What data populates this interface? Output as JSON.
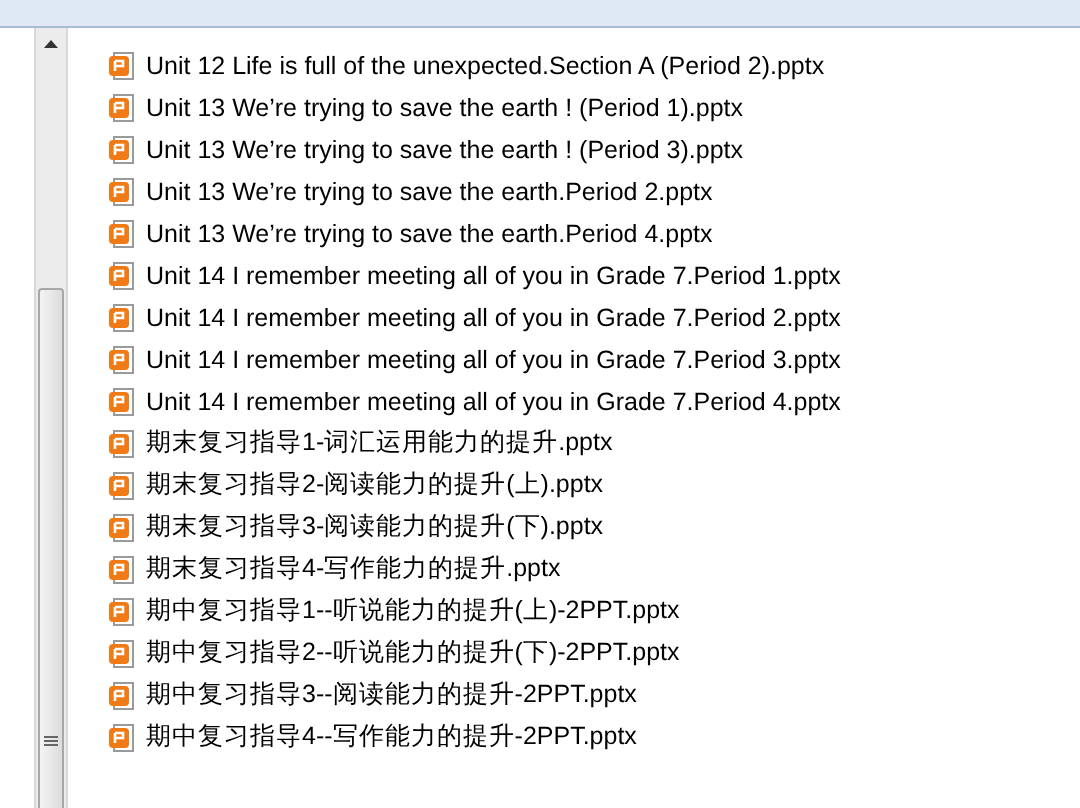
{
  "files": [
    {
      "name": "Unit 12 Life is full of the unexpected.Section A (Period 2).pptx",
      "selected": false
    },
    {
      "name": "Unit 13 We’re trying to save the earth ! (Period 1).pptx",
      "selected": false
    },
    {
      "name": "Unit 13 We’re trying to save the earth ! (Period 3).pptx",
      "selected": false
    },
    {
      "name": "Unit 13 We’re trying to save the earth.Period 2.pptx",
      "selected": false
    },
    {
      "name": "Unit 13 We’re trying to save the earth.Period 4.pptx",
      "selected": false
    },
    {
      "name": "Unit 14 I remember meeting all of you in Grade 7.Period 1.pptx",
      "selected": false
    },
    {
      "name": "Unit 14 I remember meeting all of you in Grade 7.Period 2.pptx",
      "selected": false
    },
    {
      "name": "Unit 14 I remember meeting all of you in Grade 7.Period 3.pptx",
      "selected": false
    },
    {
      "name": "Unit 14 I remember meeting all of you in Grade 7.Period 4.pptx",
      "selected": false
    },
    {
      "name": "期末复习指导1-词汇运用能力的提升.pptx",
      "selected": false
    },
    {
      "name": "期末复习指导2-阅读能力的提升(上).pptx",
      "selected": false
    },
    {
      "name": "期末复习指导3-阅读能力的提升(下).pptx",
      "selected": false
    },
    {
      "name": "期末复习指导4-写作能力的提升.pptx",
      "selected": false
    },
    {
      "name": "期中复习指导1--听说能力的提升(上)-2PPT.pptx",
      "selected": false
    },
    {
      "name": "期中复习指导2--听说能力的提升(下)-2PPT.pptx",
      "selected": false
    },
    {
      "name": "期中复习指导3--阅读能力的提升-2PPT.pptx",
      "selected": false
    },
    {
      "name": "期中复习指导4--写作能力的提升-2PPT.pptx",
      "selected": false
    }
  ]
}
